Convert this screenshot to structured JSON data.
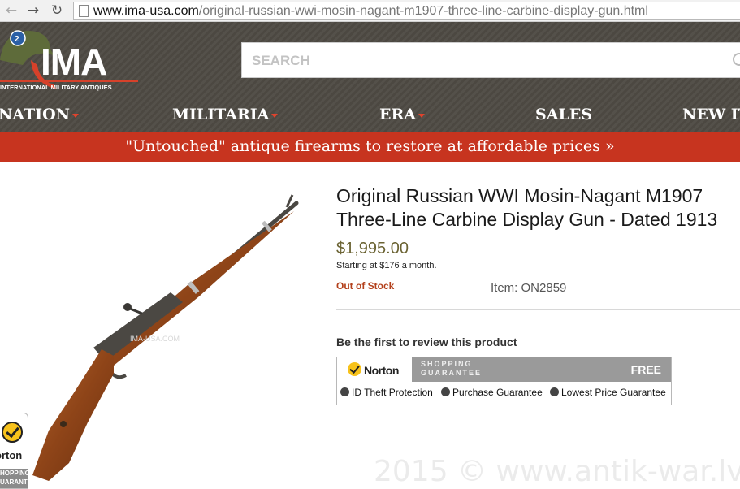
{
  "browser": {
    "url_domain": "www.ima-usa.com",
    "url_path": "/original-russian-wwi-mosin-nagant-m1907-three-line-carbine-display-gun.html",
    "back_icon": "arrow-left-icon",
    "forward_icon": "arrow-right-icon",
    "reload_icon": "reload-icon"
  },
  "header": {
    "logo_text": "IMA",
    "logo_tagline": "INTERNATIONAL MILITARY ANTIQUES",
    "search_placeholder": "SEARCH",
    "nav": [
      {
        "label": "NATION",
        "has_dropdown": true
      },
      {
        "label": "MILITARIA",
        "has_dropdown": true
      },
      {
        "label": "ERA",
        "has_dropdown": true
      },
      {
        "label": "SALES",
        "has_dropdown": false
      },
      {
        "label": "NEW IT",
        "has_dropdown": false
      }
    ],
    "promo_text": "\"Untouched\" antique firearms to restore at affordable prices »"
  },
  "product": {
    "image_watermark": "IMA-USA.COM",
    "title": "Original Russian WWI Mosin-Nagant M1907 Three-Line Carbine Display Gun - Dated 1913",
    "price": "$1,995.00",
    "monthly": "Starting at $176 a month.",
    "stock_status": "Out of Stock",
    "item_number": "Item: ON2859",
    "review_prompt": "Be the first to review this product"
  },
  "norton": {
    "brand": "Norton",
    "guarantee_label": "SHOPPING GUARANTEE",
    "free_label": "FREE",
    "features": [
      "ID Theft Protection",
      "Purchase Guarantee",
      "Lowest Price Guarantee"
    ]
  },
  "badge": {
    "brand": "orton",
    "band_text": "HOPPING UARANTEE"
  },
  "watermark": "2015 © www.antik-war.lv",
  "colors": {
    "header_bg": "#4f4b44",
    "promo_bg": "#c7341f",
    "accent_red": "#e0432d",
    "price": "#6b6333",
    "stock": "#b3401b"
  }
}
